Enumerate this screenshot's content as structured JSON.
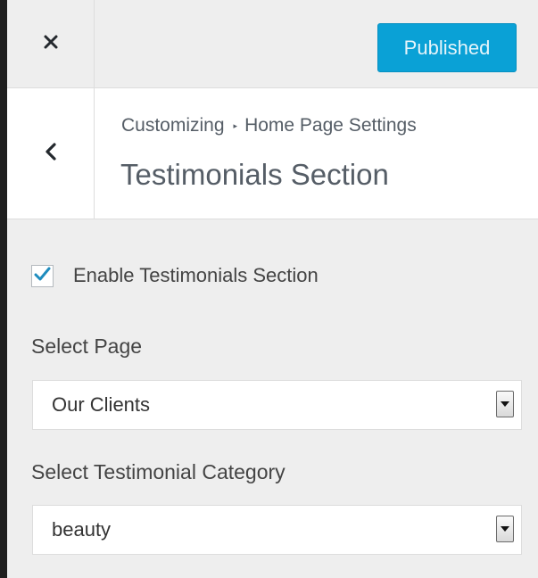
{
  "header": {
    "close_icon": "close-icon",
    "publish_label": "Published",
    "publish_color": "#0aa1d6"
  },
  "section": {
    "back_icon": "chevron-left-icon",
    "breadcrumb_root": "Customizing",
    "breadcrumb_separator": "▸",
    "breadcrumb_parent": "Home Page Settings",
    "title": "Testimonials Section"
  },
  "controls": {
    "enable_checkbox": {
      "label": "Enable Testimonials Section",
      "checked": true,
      "check_color": "#1e8cbe"
    },
    "select_page": {
      "label": "Select Page",
      "value": "Our Clients"
    },
    "select_category": {
      "label": "Select Testimonial Category",
      "value": "beauty"
    }
  }
}
